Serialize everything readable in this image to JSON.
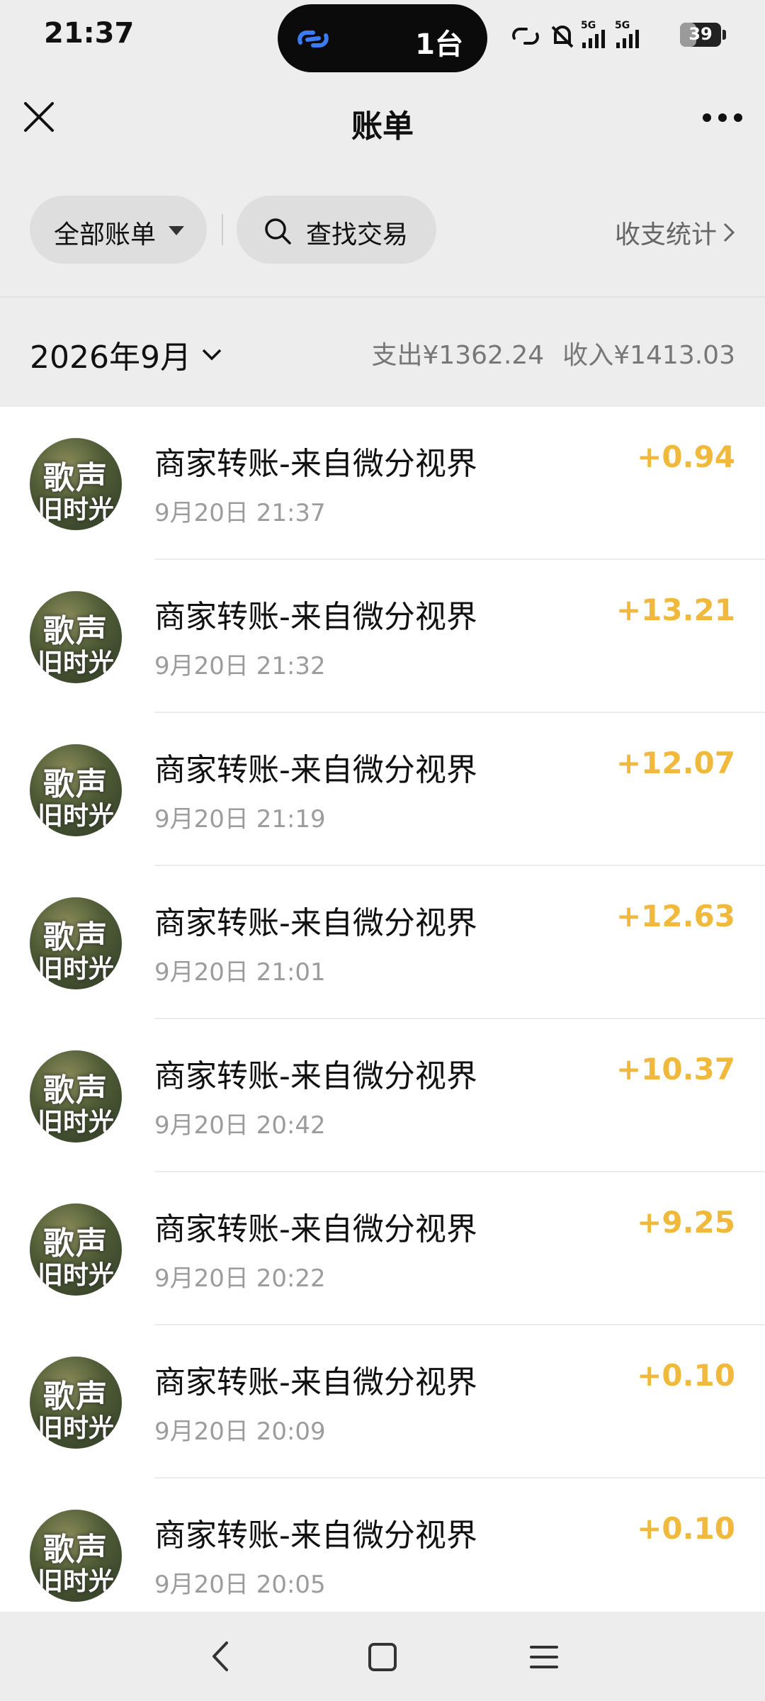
{
  "status": {
    "time": "21:37",
    "pill_text": "1台",
    "battery": "39",
    "battery_level": 0.39,
    "network": "5G"
  },
  "nav": {
    "title": "账单"
  },
  "filters": {
    "all_bills": "全部账单",
    "search": "查找交易",
    "stats": "收支统计"
  },
  "month": {
    "label": "2026年9月",
    "expense": "支出¥1362.24",
    "income": "收入¥1413.03"
  },
  "avatar": {
    "line1": "歌声",
    "line2": "旧时光"
  },
  "transactions": [
    {
      "title": "商家转账-来自微分视界",
      "time": "9月20日 21:37",
      "amount": "+0.94"
    },
    {
      "title": "商家转账-来自微分视界",
      "time": "9月20日 21:32",
      "amount": "+13.21"
    },
    {
      "title": "商家转账-来自微分视界",
      "time": "9月20日 21:19",
      "amount": "+12.07"
    },
    {
      "title": "商家转账-来自微分视界",
      "time": "9月20日 21:01",
      "amount": "+12.63"
    },
    {
      "title": "商家转账-来自微分视界",
      "time": "9月20日 20:42",
      "amount": "+10.37"
    },
    {
      "title": "商家转账-来自微分视界",
      "time": "9月20日 20:22",
      "amount": "+9.25"
    },
    {
      "title": "商家转账-来自微分视界",
      "time": "9月20日 20:09",
      "amount": "+0.10"
    },
    {
      "title": "商家转账-来自微分视界",
      "time": "9月20日 20:05",
      "amount": "+0.10"
    }
  ],
  "colors": {
    "income_amount": "#f0b93c",
    "background": "#ededed"
  }
}
